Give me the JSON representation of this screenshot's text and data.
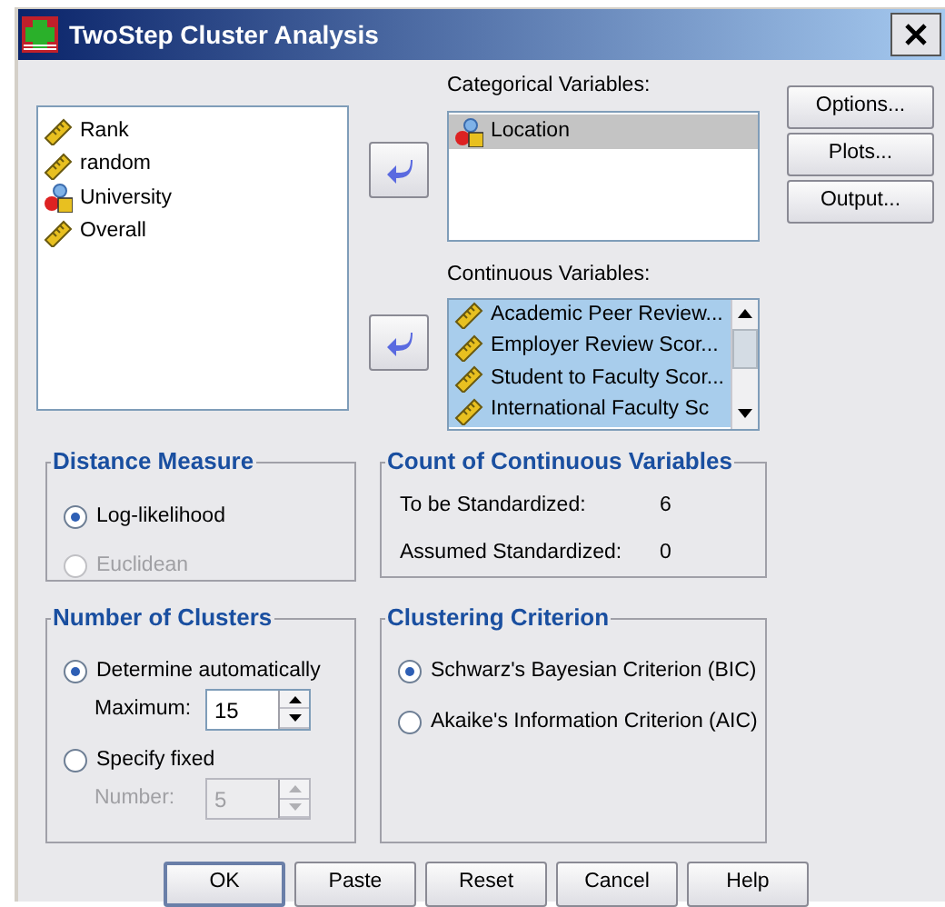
{
  "window": {
    "title": "TwoStep Cluster Analysis"
  },
  "source_list": {
    "items": [
      {
        "label": "Rank",
        "kind": "scale",
        "selected": false
      },
      {
        "label": "random",
        "kind": "scale",
        "selected": false
      },
      {
        "label": "University",
        "kind": "nominal",
        "selected": false
      },
      {
        "label": "Overall",
        "kind": "scale",
        "selected": false
      }
    ]
  },
  "categorical": {
    "label": "Categorical Variables:",
    "items": [
      {
        "label": "Location",
        "kind": "nominal",
        "selected": true
      }
    ]
  },
  "continuous": {
    "label": "Continuous Variables:",
    "items": [
      {
        "label": "Academic Peer Review...",
        "kind": "scale",
        "selected": true
      },
      {
        "label": "Employer Review Scor...",
        "kind": "scale",
        "selected": true
      },
      {
        "label": "Student to Faculty Scor...",
        "kind": "scale",
        "selected": true
      },
      {
        "label": "International Faculty Sc",
        "kind": "scale",
        "selected": true
      }
    ]
  },
  "side_buttons": [
    "Options...",
    "Plots...",
    "Output..."
  ],
  "distance_measure": {
    "title": "Distance Measure",
    "options": [
      {
        "label": "Log-likelihood",
        "selected": true,
        "disabled": false
      },
      {
        "label": "Euclidean",
        "selected": false,
        "disabled": true
      }
    ]
  },
  "count": {
    "title": "Count of Continuous Variables",
    "rows": [
      {
        "label": "To be Standardized:",
        "value": "6"
      },
      {
        "label": "Assumed Standardized:",
        "value": "0"
      }
    ]
  },
  "number_of_clusters": {
    "title": "Number of Clusters",
    "options": [
      {
        "label": "Determine automatically",
        "selected": true,
        "spinner": {
          "label": "Maximum:",
          "value": "15",
          "disabled": false
        }
      },
      {
        "label": "Specify fixed",
        "selected": false,
        "spinner": {
          "label": "Number:",
          "value": "5",
          "disabled": true
        }
      }
    ]
  },
  "criterion": {
    "title": "Clustering Criterion",
    "options": [
      {
        "label": "Schwarz's Bayesian Criterion (BIC)",
        "selected": true
      },
      {
        "label": "Akaike's Information Criterion (AIC)",
        "selected": false
      }
    ]
  },
  "buttons": [
    {
      "label": "OK",
      "default": true
    },
    {
      "label": "Paste",
      "default": false
    },
    {
      "label": "Reset",
      "default": false
    },
    {
      "label": "Cancel",
      "default": false
    },
    {
      "label": "Help",
      "default": false
    }
  ]
}
